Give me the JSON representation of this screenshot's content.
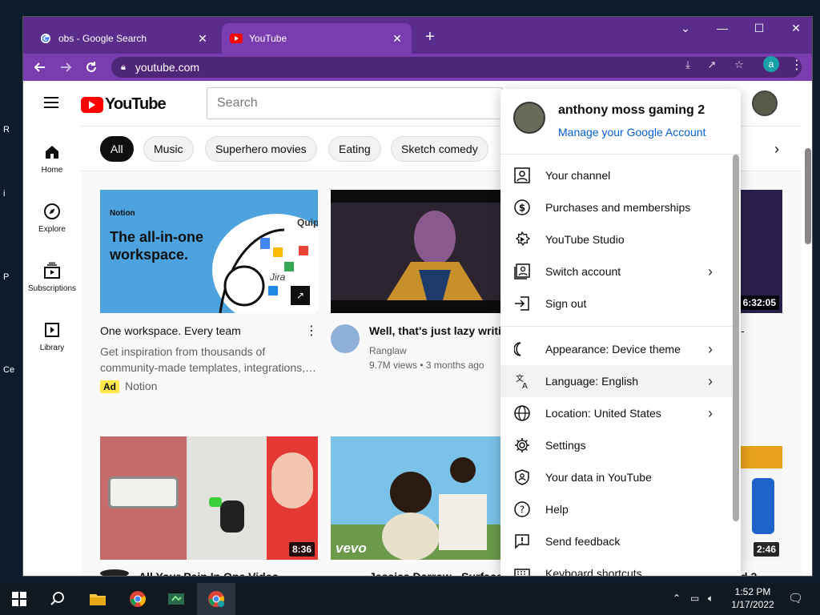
{
  "desktop": {
    "icon_fragments": [
      "R",
      "i",
      "P",
      "Ce"
    ]
  },
  "browser": {
    "tabs": [
      {
        "title": "obs - Google Search",
        "icon": "google-icon",
        "active": false
      },
      {
        "title": "YouTube",
        "icon": "youtube-icon",
        "active": true
      }
    ],
    "new_tab": "+",
    "url": "youtube.com",
    "profile_letter": "a",
    "window_controls": [
      "⌄",
      "—",
      "☐",
      "✕"
    ],
    "theme_color": "#7a3db0"
  },
  "youtube": {
    "logo_text": "YouTube",
    "search_placeholder": "Search",
    "sidebar": [
      {
        "label": "Home",
        "icon": "home-icon"
      },
      {
        "label": "Explore",
        "icon": "compass-icon"
      },
      {
        "label": "Subscriptions",
        "icon": "subscriptions-icon"
      },
      {
        "label": "Library",
        "icon": "library-icon"
      }
    ],
    "chips": [
      "All",
      "Music",
      "Superhero movies",
      "Eating",
      "Sketch comedy"
    ],
    "videos": [
      {
        "title": "One workspace. Every team",
        "description": "Get inspiration from thousands of community-made templates, integrations,…",
        "ad_badge": "Ad",
        "channel": "Notion",
        "thumb_brand": "Notion",
        "thumb_text_1": "The all-in-one",
        "thumb_text_2": "workspace.",
        "thumb_labels": [
          "Quip",
          "Jira"
        ]
      },
      {
        "title": "Well, that's just lazy writing",
        "channel": "Ranglaw",
        "meta": "9.7M views • 3 months ago"
      },
      {
        "title": "All Your Pain In One Video",
        "duration": "8:36"
      },
      {
        "title": "Jessica Darrow - Surface",
        "watermark": "vevo"
      },
      {
        "title_fragment": "-",
        "duration": "6:32:05"
      },
      {
        "title_fragment": "d 2",
        "duration": "2:46"
      }
    ]
  },
  "account_menu": {
    "name": "anthony moss gaming 2",
    "manage_link": "Manage your Google Account",
    "items": [
      {
        "label": "Your channel",
        "icon": "person-icon",
        "chevron": false
      },
      {
        "label": "Purchases and memberships",
        "icon": "dollar-icon",
        "chevron": false
      },
      {
        "label": "YouTube Studio",
        "icon": "studio-gear-icon",
        "chevron": false
      },
      {
        "label": "Switch account",
        "icon": "switch-account-icon",
        "chevron": true
      },
      {
        "label": "Sign out",
        "icon": "sign-out-icon",
        "chevron": false
      },
      {
        "label": "Appearance: Device theme",
        "icon": "moon-icon",
        "chevron": true
      },
      {
        "label": "Language: English",
        "icon": "translate-icon",
        "chevron": true,
        "highlighted": true
      },
      {
        "label": "Location: United States",
        "icon": "globe-icon",
        "chevron": true
      },
      {
        "label": "Settings",
        "icon": "gear-icon",
        "chevron": false
      },
      {
        "label": "Your data in YouTube",
        "icon": "shield-person-icon",
        "chevron": false
      },
      {
        "label": "Help",
        "icon": "help-icon",
        "chevron": false
      },
      {
        "label": "Send feedback",
        "icon": "feedback-icon",
        "chevron": false
      },
      {
        "label": "Keyboard shortcuts",
        "icon": "keyboard-icon",
        "chevron": false
      }
    ]
  },
  "taskbar": {
    "time": "1:52 PM",
    "date": "1/17/2022"
  }
}
